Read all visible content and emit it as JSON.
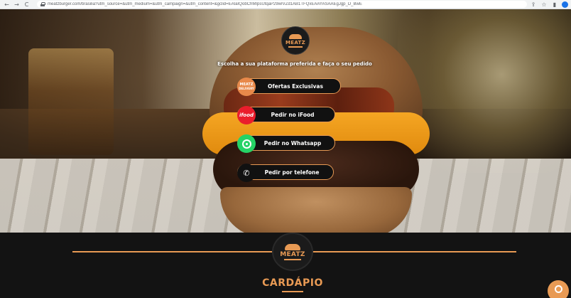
{
  "browser": {
    "url": "meatzburger.com/brasilia?utm_source=&utm_medium=&utm_campaign=&utm_content=&gclid=EAIaIQobChMIpsUtqaP29wIVZd1AB1TFQxEAAYASAAEgJgp_D_BwE",
    "back_icon": "←",
    "forward_icon": "→",
    "reload_icon": "C"
  },
  "hero": {
    "logo_text": "MEATZ",
    "tagline": "Escolha a sua plataforma preferida e faça o seu pedido",
    "buttons": [
      {
        "label": "Ofertas Exclusivas",
        "icon": "meatz-delivery-icon",
        "icon_text_1": "MEATZ",
        "icon_text_2": "DELIVERY"
      },
      {
        "label": "Pedir no iFood",
        "icon": "ifood-icon",
        "icon_text": "ifood"
      },
      {
        "label": "Pedir no Whatsapp",
        "icon": "whatsapp-icon"
      },
      {
        "label": "Pedir por telefone",
        "icon": "phone-icon"
      }
    ]
  },
  "menu_section": {
    "logo_text": "MEATZ",
    "heading": "CARDÁPIO"
  },
  "colors": {
    "accent": "#e89a54",
    "ifood": "#ea1d2c",
    "whatsapp": "#25d366"
  }
}
